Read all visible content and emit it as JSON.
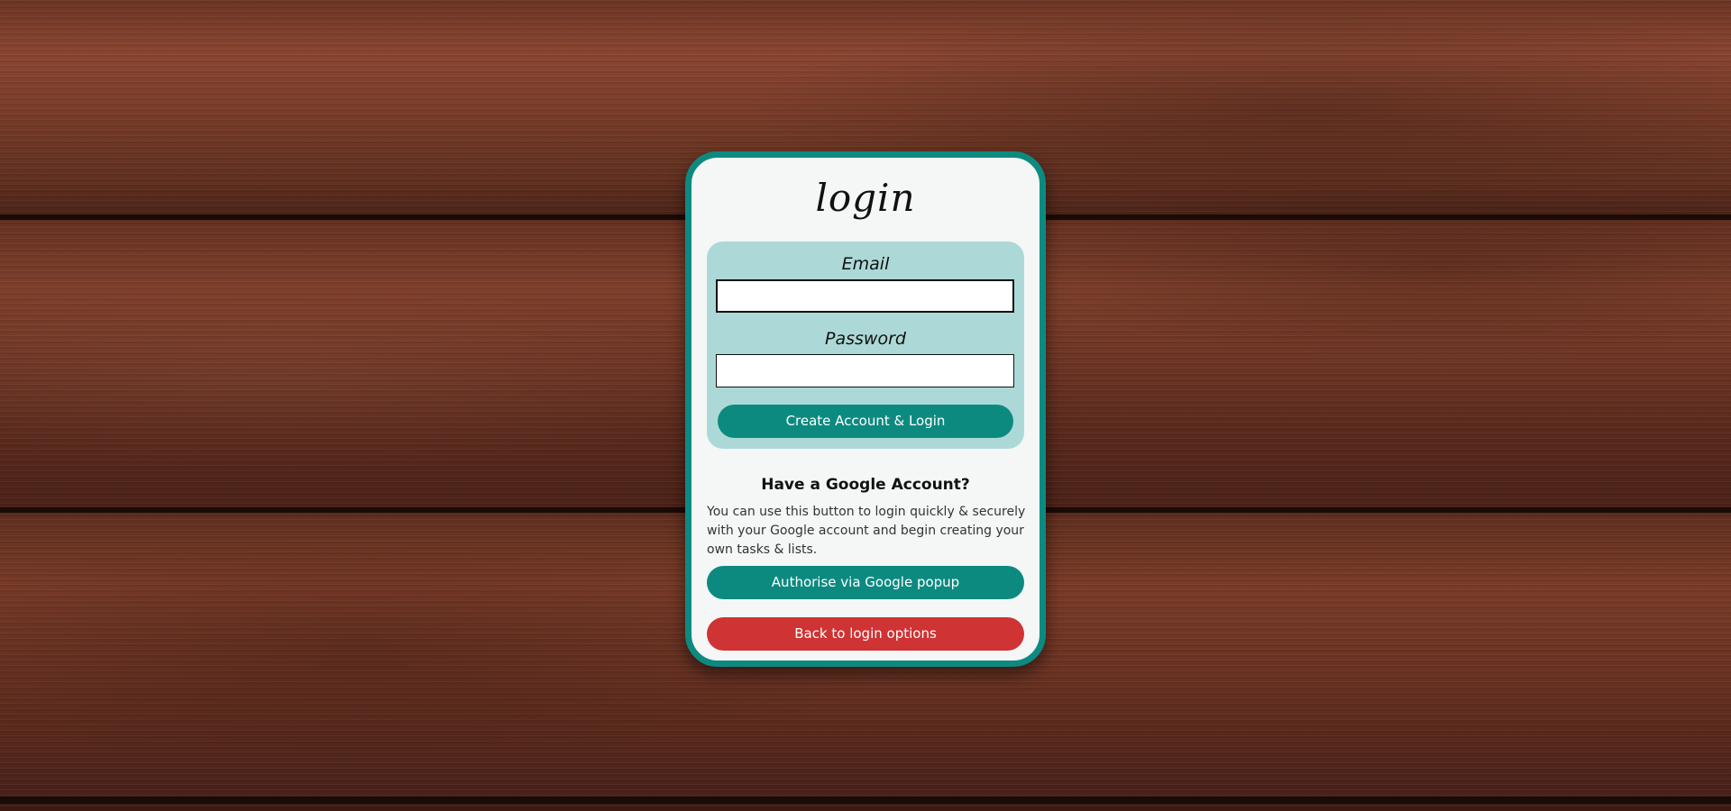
{
  "login_card": {
    "title": "login",
    "email_label": "Email",
    "email_value": "",
    "password_label": "Password",
    "password_value": "",
    "create_account_button": "Create Account & Login",
    "google_heading": "Have a Google Account?",
    "google_description": "You can use this button to login quickly & securely with your Google account and begin creating your own tasks & lists.",
    "google_button": "Authorise via Google popup",
    "back_button": "Back to login options"
  },
  "colors": {
    "accent": "#0d8a80",
    "panel": "#acd9d7",
    "danger": "#cf3333",
    "card_background": "#f5f6f6"
  }
}
